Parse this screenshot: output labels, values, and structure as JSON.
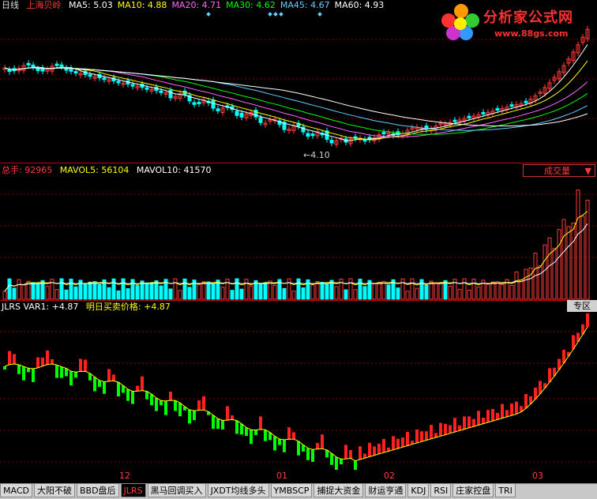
{
  "price_panel": {
    "period": "日线",
    "stock_name": "上海贝岭",
    "ma_items": [
      {
        "label": "MA5: 5.03",
        "color": "#ffffff"
      },
      {
        "label": "MA10: 4.88",
        "color": "#ffff00"
      },
      {
        "label": "MA20: 4.71",
        "color": "#ff66ff"
      },
      {
        "label": "MA30: 4.62",
        "color": "#00ff00"
      },
      {
        "label": "MA45: 4.67",
        "color": "#66ccff"
      },
      {
        "label": "MA60: 4.93",
        "color": "#ffffff"
      }
    ],
    "low_marker": "4.10"
  },
  "volume_panel": {
    "total_label": "总手: 92965",
    "mavol5_label": "MAVOL5: 56104",
    "mavol10_label": "MAVOL10: 41570",
    "indicator_select": "成交量",
    "dropdown_arrow": "▼"
  },
  "jlrs_panel": {
    "var_label": "JLRS VAR1: +4.87",
    "price_label": "明日买卖价格: +4.87",
    "zone_button": "专区"
  },
  "x_axis": {
    "labels": [
      "12",
      "01",
      "02",
      "03"
    ]
  },
  "logo": {
    "title": "分析家公式网",
    "url": "www.88gs.com"
  },
  "tabs": [
    "MACD",
    "大阳不破",
    "BBD盘后",
    "JLRS",
    "黑马回调买入",
    "JXDT均线多头",
    "YMBSCP",
    "捕捉大资金",
    "财运亨通",
    "KDJ",
    "RSI",
    "庄家控盘",
    "TRI"
  ],
  "active_tab": "JLRS",
  "colors": {
    "up": "#ff3b3b",
    "down": "#00ffff",
    "bar_up": "#ff2020",
    "bar_down": "#00ff00",
    "grid": "#800000"
  }
}
